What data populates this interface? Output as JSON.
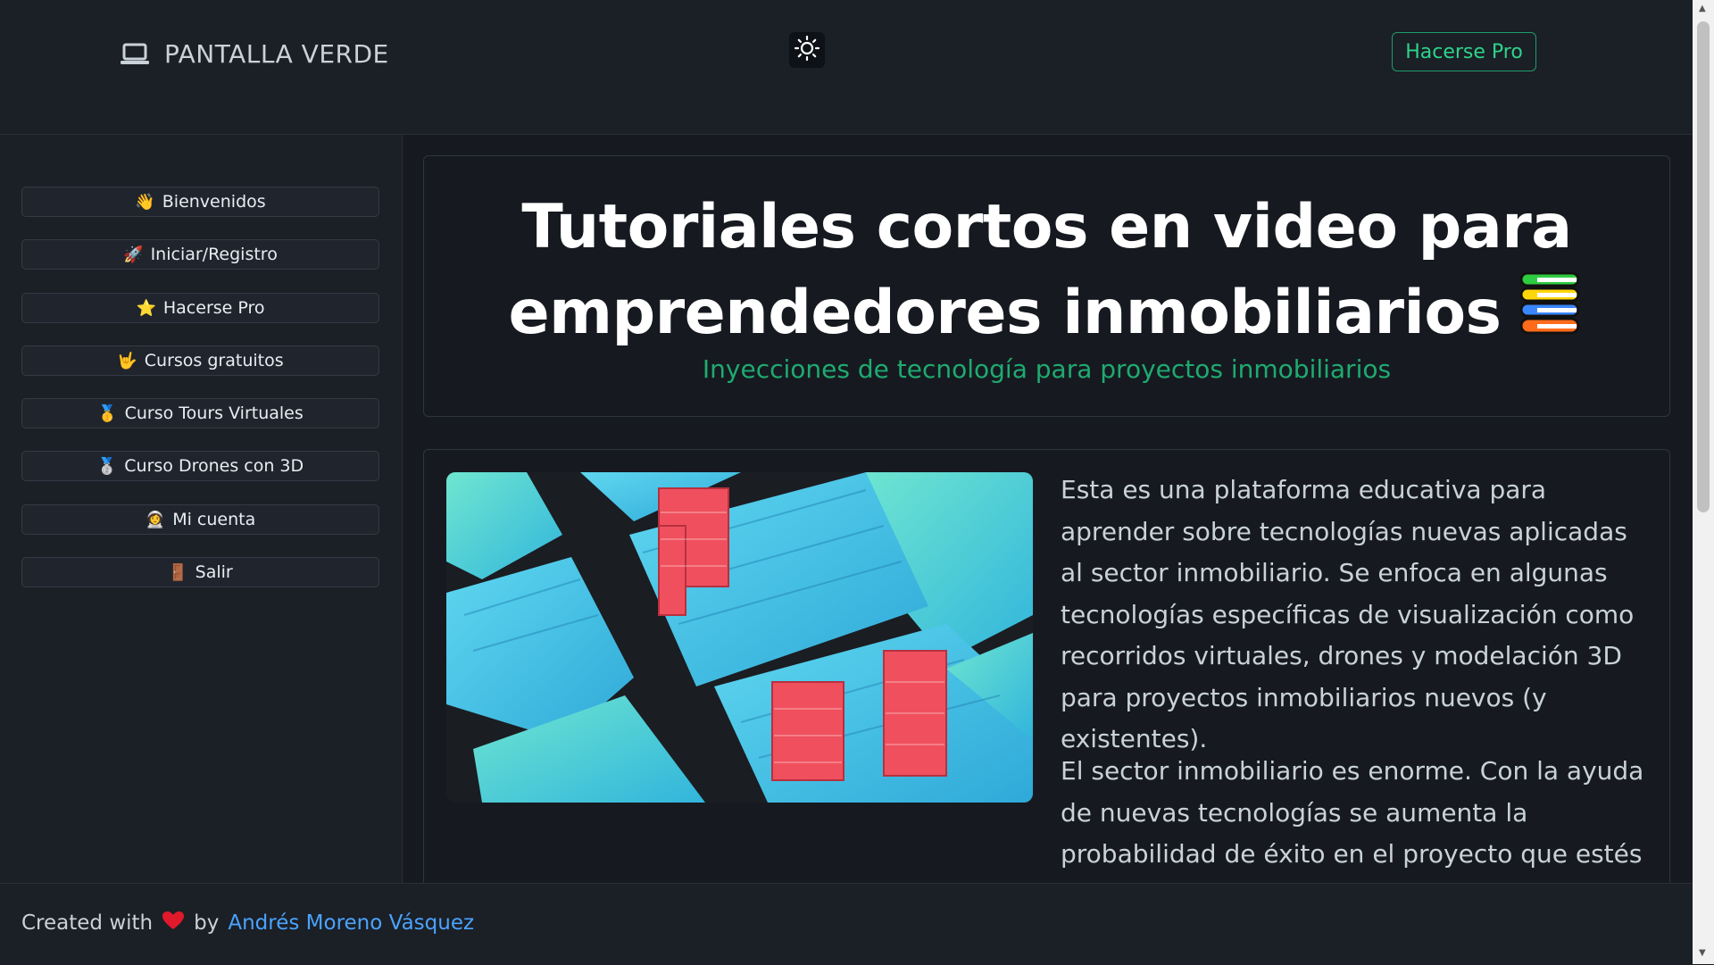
{
  "header": {
    "brand_title": "PANTALLA VERDE",
    "pro_button": "Hacerse Pro"
  },
  "sidebar": {
    "items": [
      {
        "emoji": "👋",
        "label": "Bienvenidos"
      },
      {
        "emoji": "🚀",
        "label": "Iniciar/Registro"
      },
      {
        "emoji": "⭐",
        "label": "Hacerse Pro"
      },
      {
        "emoji": "🤟",
        "label": "Cursos gratuitos"
      },
      {
        "emoji": "🥇",
        "label": "Curso Tours Virtuales"
      },
      {
        "emoji": "🥈",
        "label": "Curso Drones con 3D"
      },
      {
        "emoji": "👩‍🚀",
        "label": "Mi cuenta"
      },
      {
        "emoji": "🚪",
        "label": "Salir"
      }
    ]
  },
  "hero": {
    "title_line1": "Tutoriales cortos en video para",
    "title_line2": "emprendedores inmobiliarios",
    "subtitle": "Inyecciones de tecnología para proyectos inmobiliarios"
  },
  "content": {
    "paragraph1": "Esta es una plataforma educativa para aprender sobre tecnologías nuevas aplicadas al sector inmobiliario. Se enfoca en algunas tecnologías específicas de visualización como recorridos virtuales, drones y modelación 3D para proyectos inmobiliarios nuevos (y existentes).",
    "paragraph2": "El sector inmobiliario es enorme. Con la ayuda de nuevas tecnologías se aumenta la probabilidad de éxito en el proyecto que estés trabajando o"
  },
  "footer": {
    "created_with": "Created with",
    "by": "by",
    "author": "Andrés Moreno Vásquez"
  },
  "colors": {
    "accent_green": "#1faa70",
    "link_blue": "#4aa3ff",
    "background": "#161a20"
  },
  "icons": {
    "brand": "laptop-icon",
    "theme": "sun-icon",
    "footer_heart": "heart-icon",
    "hero_emoji": "books-icon"
  }
}
